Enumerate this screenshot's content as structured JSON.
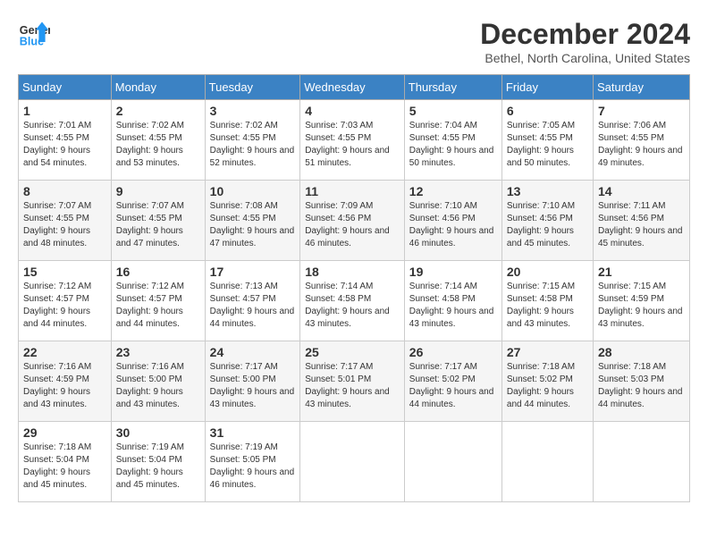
{
  "header": {
    "logo_line1": "General",
    "logo_line2": "Blue",
    "month": "December 2024",
    "location": "Bethel, North Carolina, United States"
  },
  "weekdays": [
    "Sunday",
    "Monday",
    "Tuesday",
    "Wednesday",
    "Thursday",
    "Friday",
    "Saturday"
  ],
  "weeks": [
    [
      {
        "day": "1",
        "sunrise": "7:01 AM",
        "sunset": "4:55 PM",
        "daylight": "9 hours and 54 minutes."
      },
      {
        "day": "2",
        "sunrise": "7:02 AM",
        "sunset": "4:55 PM",
        "daylight": "9 hours and 53 minutes."
      },
      {
        "day": "3",
        "sunrise": "7:02 AM",
        "sunset": "4:55 PM",
        "daylight": "9 hours and 52 minutes."
      },
      {
        "day": "4",
        "sunrise": "7:03 AM",
        "sunset": "4:55 PM",
        "daylight": "9 hours and 51 minutes."
      },
      {
        "day": "5",
        "sunrise": "7:04 AM",
        "sunset": "4:55 PM",
        "daylight": "9 hours and 50 minutes."
      },
      {
        "day": "6",
        "sunrise": "7:05 AM",
        "sunset": "4:55 PM",
        "daylight": "9 hours and 50 minutes."
      },
      {
        "day": "7",
        "sunrise": "7:06 AM",
        "sunset": "4:55 PM",
        "daylight": "9 hours and 49 minutes."
      }
    ],
    [
      {
        "day": "8",
        "sunrise": "7:07 AM",
        "sunset": "4:55 PM",
        "daylight": "9 hours and 48 minutes."
      },
      {
        "day": "9",
        "sunrise": "7:07 AM",
        "sunset": "4:55 PM",
        "daylight": "9 hours and 47 minutes."
      },
      {
        "day": "10",
        "sunrise": "7:08 AM",
        "sunset": "4:55 PM",
        "daylight": "9 hours and 47 minutes."
      },
      {
        "day": "11",
        "sunrise": "7:09 AM",
        "sunset": "4:56 PM",
        "daylight": "9 hours and 46 minutes."
      },
      {
        "day": "12",
        "sunrise": "7:10 AM",
        "sunset": "4:56 PM",
        "daylight": "9 hours and 46 minutes."
      },
      {
        "day": "13",
        "sunrise": "7:10 AM",
        "sunset": "4:56 PM",
        "daylight": "9 hours and 45 minutes."
      },
      {
        "day": "14",
        "sunrise": "7:11 AM",
        "sunset": "4:56 PM",
        "daylight": "9 hours and 45 minutes."
      }
    ],
    [
      {
        "day": "15",
        "sunrise": "7:12 AM",
        "sunset": "4:57 PM",
        "daylight": "9 hours and 44 minutes."
      },
      {
        "day": "16",
        "sunrise": "7:12 AM",
        "sunset": "4:57 PM",
        "daylight": "9 hours and 44 minutes."
      },
      {
        "day": "17",
        "sunrise": "7:13 AM",
        "sunset": "4:57 PM",
        "daylight": "9 hours and 44 minutes."
      },
      {
        "day": "18",
        "sunrise": "7:14 AM",
        "sunset": "4:58 PM",
        "daylight": "9 hours and 43 minutes."
      },
      {
        "day": "19",
        "sunrise": "7:14 AM",
        "sunset": "4:58 PM",
        "daylight": "9 hours and 43 minutes."
      },
      {
        "day": "20",
        "sunrise": "7:15 AM",
        "sunset": "4:58 PM",
        "daylight": "9 hours and 43 minutes."
      },
      {
        "day": "21",
        "sunrise": "7:15 AM",
        "sunset": "4:59 PM",
        "daylight": "9 hours and 43 minutes."
      }
    ],
    [
      {
        "day": "22",
        "sunrise": "7:16 AM",
        "sunset": "4:59 PM",
        "daylight": "9 hours and 43 minutes."
      },
      {
        "day": "23",
        "sunrise": "7:16 AM",
        "sunset": "5:00 PM",
        "daylight": "9 hours and 43 minutes."
      },
      {
        "day": "24",
        "sunrise": "7:17 AM",
        "sunset": "5:00 PM",
        "daylight": "9 hours and 43 minutes."
      },
      {
        "day": "25",
        "sunrise": "7:17 AM",
        "sunset": "5:01 PM",
        "daylight": "9 hours and 43 minutes."
      },
      {
        "day": "26",
        "sunrise": "7:17 AM",
        "sunset": "5:02 PM",
        "daylight": "9 hours and 44 minutes."
      },
      {
        "day": "27",
        "sunrise": "7:18 AM",
        "sunset": "5:02 PM",
        "daylight": "9 hours and 44 minutes."
      },
      {
        "day": "28",
        "sunrise": "7:18 AM",
        "sunset": "5:03 PM",
        "daylight": "9 hours and 44 minutes."
      }
    ],
    [
      {
        "day": "29",
        "sunrise": "7:18 AM",
        "sunset": "5:04 PM",
        "daylight": "9 hours and 45 minutes."
      },
      {
        "day": "30",
        "sunrise": "7:19 AM",
        "sunset": "5:04 PM",
        "daylight": "9 hours and 45 minutes."
      },
      {
        "day": "31",
        "sunrise": "7:19 AM",
        "sunset": "5:05 PM",
        "daylight": "9 hours and 46 minutes."
      },
      null,
      null,
      null,
      null
    ]
  ]
}
